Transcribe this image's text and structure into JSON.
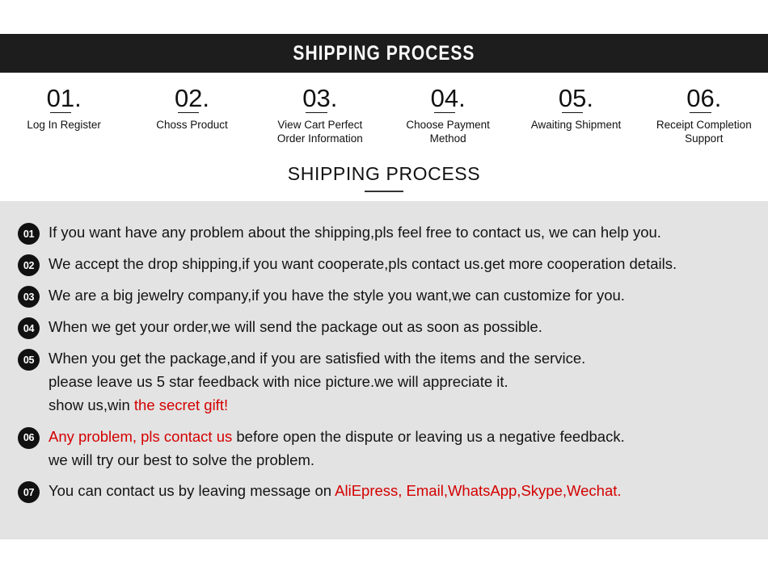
{
  "banner": {
    "title": "SHIPPING PROCESS"
  },
  "steps": [
    {
      "number": "01",
      "dot": ".",
      "label": "Log In Register"
    },
    {
      "number": "02",
      "dot": ".",
      "label": "Choss Product"
    },
    {
      "number": "03",
      "dot": ".",
      "label": "View Cart Perfect\nOrder Information"
    },
    {
      "number": "04",
      "dot": ".",
      "label": "Choose Payment\nMethod"
    },
    {
      "number": "05",
      "dot": ".",
      "label": "Awaiting Shipment"
    },
    {
      "number": "06",
      "dot": ".",
      "label": "Receipt Completion\nSupport"
    }
  ],
  "subheading": {
    "title": "SHIPPING PROCESS"
  },
  "items": [
    {
      "badge": "01",
      "text": "If you want have any problem about the shipping,pls feel free to contact us, we can help you."
    },
    {
      "badge": "02",
      "text": "We accept the drop shipping,if you want cooperate,pls contact us.get more cooperation details."
    },
    {
      "badge": "03",
      "text": "We are a big jewelry company,if you have the style you want,we can customize for you."
    },
    {
      "badge": "04",
      "text": "When we get your order,we will send the package out as soon as possible."
    },
    {
      "badge": "05",
      "text_before": "When you get the package,and if you are satisfied with the items and the service.\nplease leave us 5 star feedback with nice picture.we will appreciate it.\nshow us,win ",
      "text_red": "the secret gift!",
      "text_after": ""
    },
    {
      "badge": "06",
      "text_before": "",
      "text_red": "Any problem, pls contact us",
      "text_after": " before open the dispute or leaving us a negative feedback.\nwe will try our best to solve the problem."
    },
    {
      "badge": "07",
      "text_before": "You can contact us by leaving message on ",
      "text_red": "AliEpress, Email,WhatsApp,Skype,Wechat.",
      "text_after": ""
    }
  ],
  "colors": {
    "banner_bg": "#1d1d1d",
    "content_bg": "#e3e3e3",
    "accent_red": "#d40000",
    "text": "#141414"
  }
}
